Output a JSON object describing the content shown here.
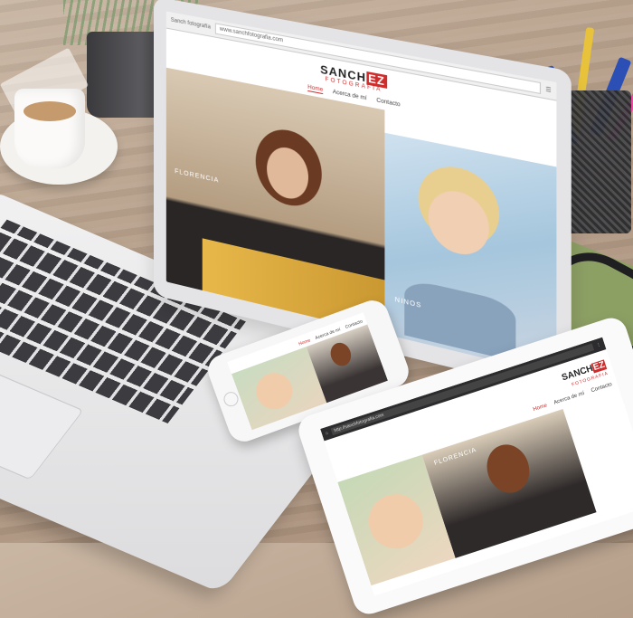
{
  "laptop": {
    "tab_title": "Sanch fotografía",
    "url": "www.sanchfotografia.com",
    "logo_main": "SANCH",
    "logo_box": "EZ",
    "logo_sub": "FOTOGRAFIA",
    "nav": [
      {
        "label": "Home"
      },
      {
        "label": "Acerca de mí"
      },
      {
        "label": "Contacto"
      }
    ],
    "captions": [
      "FLORENCIA",
      "NINOS"
    ]
  },
  "phone": {
    "nav": [
      {
        "label": "Home"
      },
      {
        "label": "Acerca de mí"
      },
      {
        "label": "Contacto"
      }
    ]
  },
  "tablet": {
    "url": "http://sanchfotografia.com",
    "logo_main": "SANCH",
    "logo_box": "EZ",
    "logo_sub": "FOTOGRAFIA",
    "nav": [
      {
        "label": "Home"
      },
      {
        "label": "Acerca de mí"
      },
      {
        "label": "Contacto"
      }
    ],
    "caption": "FLORENCIA"
  }
}
